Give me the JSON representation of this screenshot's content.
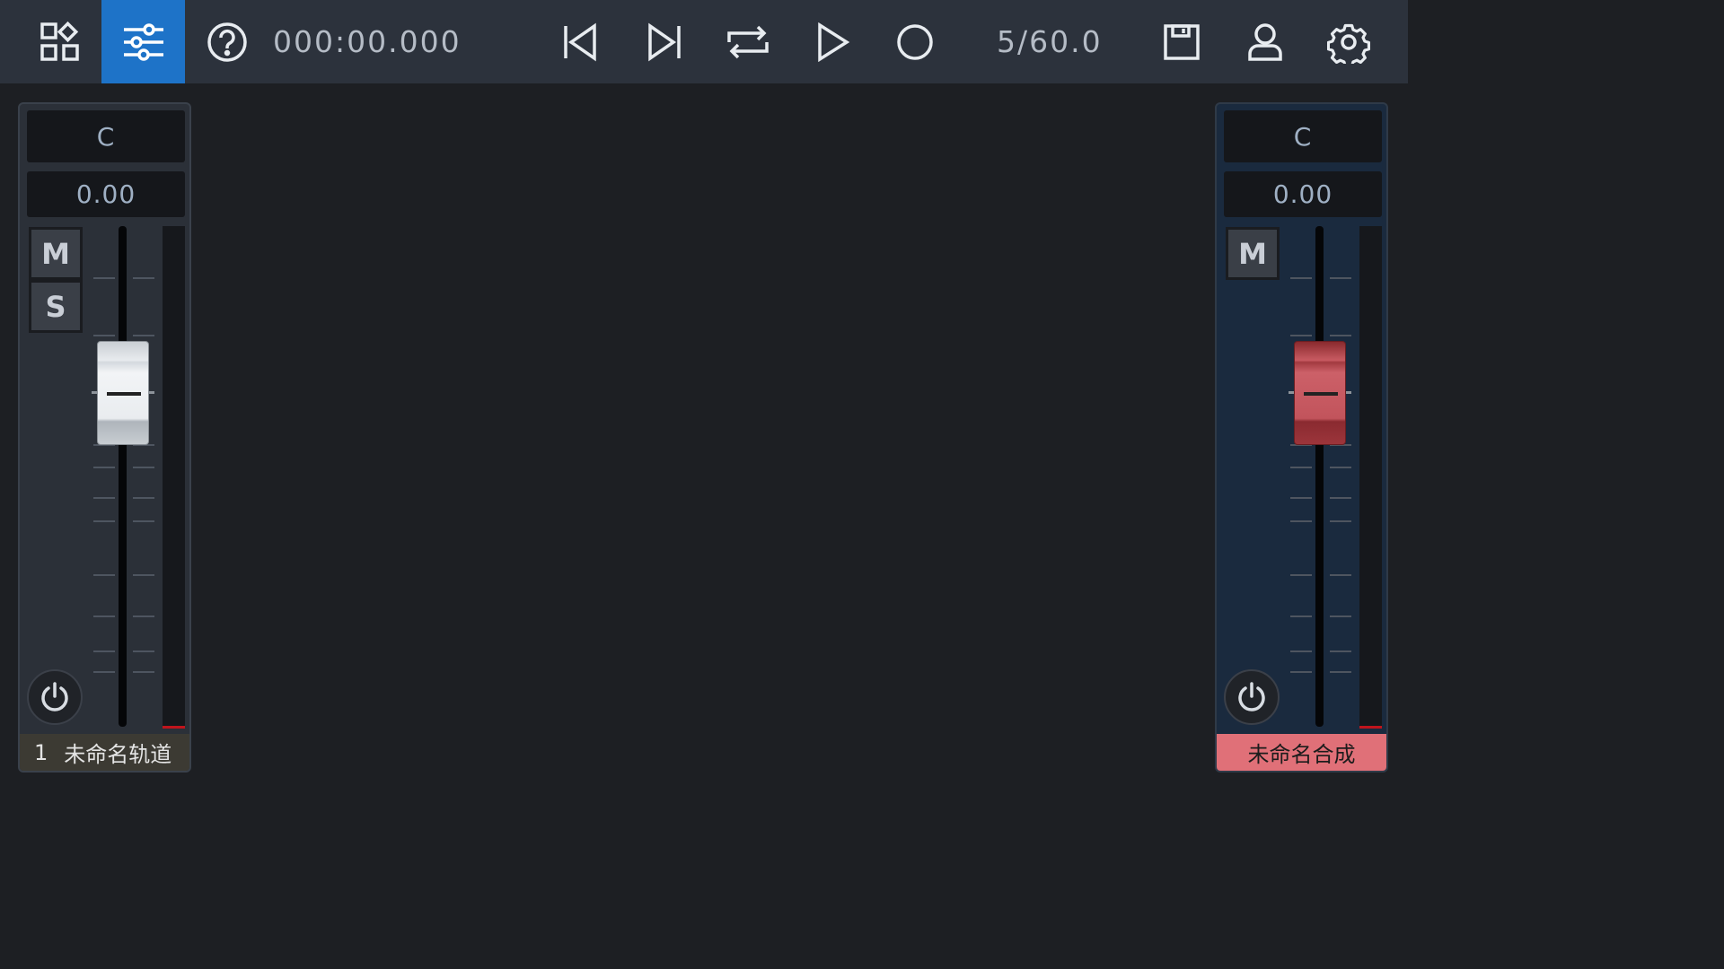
{
  "toolbar": {
    "time_display": "000:00.000",
    "position_display": "5/60.0",
    "active_color": "#1e73c8",
    "buttons": [
      {
        "name": "grid-apps-icon"
      },
      {
        "name": "mixer-sliders-icon",
        "active": true
      },
      {
        "name": "help-icon"
      },
      {
        "name": "skip-to-start-icon"
      },
      {
        "name": "skip-to-end-icon"
      },
      {
        "name": "loop-icon"
      },
      {
        "name": "play-icon"
      },
      {
        "name": "record-icon"
      },
      {
        "name": "save-icon"
      },
      {
        "name": "user-icon"
      },
      {
        "name": "settings-gear-icon"
      }
    ]
  },
  "track_strip": {
    "pan": "C",
    "volume": "0.00",
    "mute_label": "M",
    "solo_label": "S",
    "number": "1",
    "name": "未命名轨道",
    "fader_color": "white",
    "name_bar_color": "#3c3a33"
  },
  "master_strip": {
    "pan": "C",
    "volume": "0.00",
    "mute_label": "M",
    "name": "未命名合成",
    "fader_color": "red",
    "name_bar_color": "#e07078"
  }
}
